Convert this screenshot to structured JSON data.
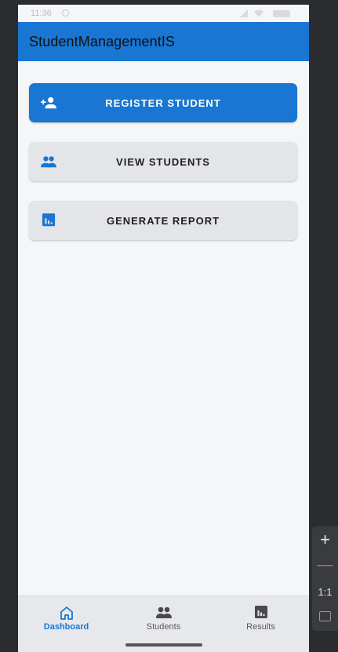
{
  "statusbar": {
    "time": "11:36"
  },
  "appbar": {
    "title": "StudentManagementIS"
  },
  "actions": {
    "register": "REGISTER STUDENT",
    "view": "VIEW STUDENTS",
    "report": "GENERATE REPORT"
  },
  "bottom_nav": {
    "items": [
      {
        "label": "Dashboard",
        "icon": "home-icon",
        "active": true
      },
      {
        "label": "Students",
        "icon": "group-icon",
        "active": false
      },
      {
        "label": "Results",
        "icon": "report-icon",
        "active": false
      }
    ]
  },
  "zoom_controls": {
    "ratio": "1:1"
  },
  "colors": {
    "primary": "#1976d2",
    "background": "#f5f6f8",
    "secondary_button": "#e4e5e8",
    "bottom_nav": "#e7e8ec"
  }
}
